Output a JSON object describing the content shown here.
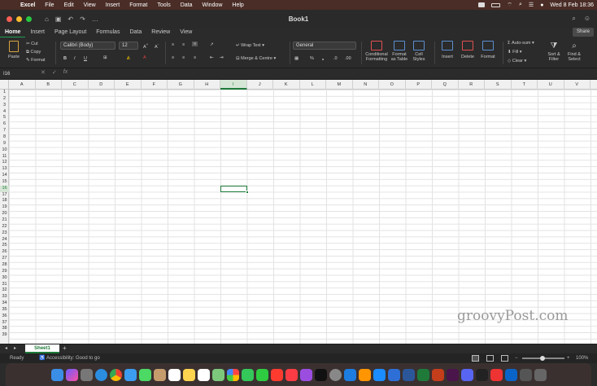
{
  "menubar": {
    "app_name": "Excel",
    "items": [
      "File",
      "Edit",
      "View",
      "Insert",
      "Format",
      "Tools",
      "Data",
      "Window",
      "Help"
    ],
    "datetime": "Wed 8 Feb  18:36"
  },
  "window": {
    "title": "Book1"
  },
  "tabs": [
    "Home",
    "Insert",
    "Page Layout",
    "Formulas",
    "Data",
    "Review",
    "View"
  ],
  "active_tab": "Home",
  "share_label": "Share",
  "ribbon": {
    "paste": "Paste",
    "cut": "Cut",
    "copy": "Copy",
    "format": "Format",
    "font_name": "Calibri (Body)",
    "font_size": "12",
    "bold": "B",
    "italic": "I",
    "underline": "U",
    "wrap_text": "Wrap Text",
    "merge_centre": "Merge & Centre",
    "number_format": "General",
    "percent": "%",
    "conditional_formatting": "Conditional Formatting",
    "format_as_table": "Format as Table",
    "cell_styles": "Cell Styles",
    "insert": "Insert",
    "delete": "Delete",
    "format_cells": "Format",
    "auto_sum": "Auto-sum",
    "fill": "Fill",
    "clear": "Clear",
    "sort_filter": "Sort & Filter",
    "find_select": "Find & Select"
  },
  "formula_bar": {
    "name_box": "I16",
    "fx": "fx",
    "value": ""
  },
  "grid": {
    "columns": [
      "A",
      "B",
      "C",
      "D",
      "E",
      "F",
      "G",
      "H",
      "I",
      "J",
      "K",
      "L",
      "M",
      "N",
      "O",
      "P",
      "Q",
      "R",
      "S",
      "T",
      "U",
      "V"
    ],
    "rows": [
      "1",
      "2",
      "3",
      "4",
      "5",
      "6",
      "7",
      "8",
      "9",
      "10",
      "11",
      "12",
      "13",
      "14",
      "15",
      "16",
      "17",
      "18",
      "19",
      "20",
      "21",
      "22",
      "23",
      "24",
      "25",
      "26",
      "27",
      "28",
      "29",
      "30",
      "31",
      "32",
      "33",
      "34",
      "35",
      "36",
      "37",
      "38",
      "39"
    ],
    "selected_column": "I",
    "selected_row": "16"
  },
  "watermark": "groovyPost.com",
  "sheets": {
    "tabs": [
      "Sheet1"
    ],
    "add": "+"
  },
  "status": {
    "ready": "Ready",
    "accessibility": "Accessibility: Good to go",
    "zoom": "100%"
  },
  "colors": {
    "accent": "#1f7a3a",
    "menubar_bg": "#4a2d26",
    "close": "#ff5f57",
    "minimize": "#febc2e",
    "maximize": "#28c840"
  }
}
